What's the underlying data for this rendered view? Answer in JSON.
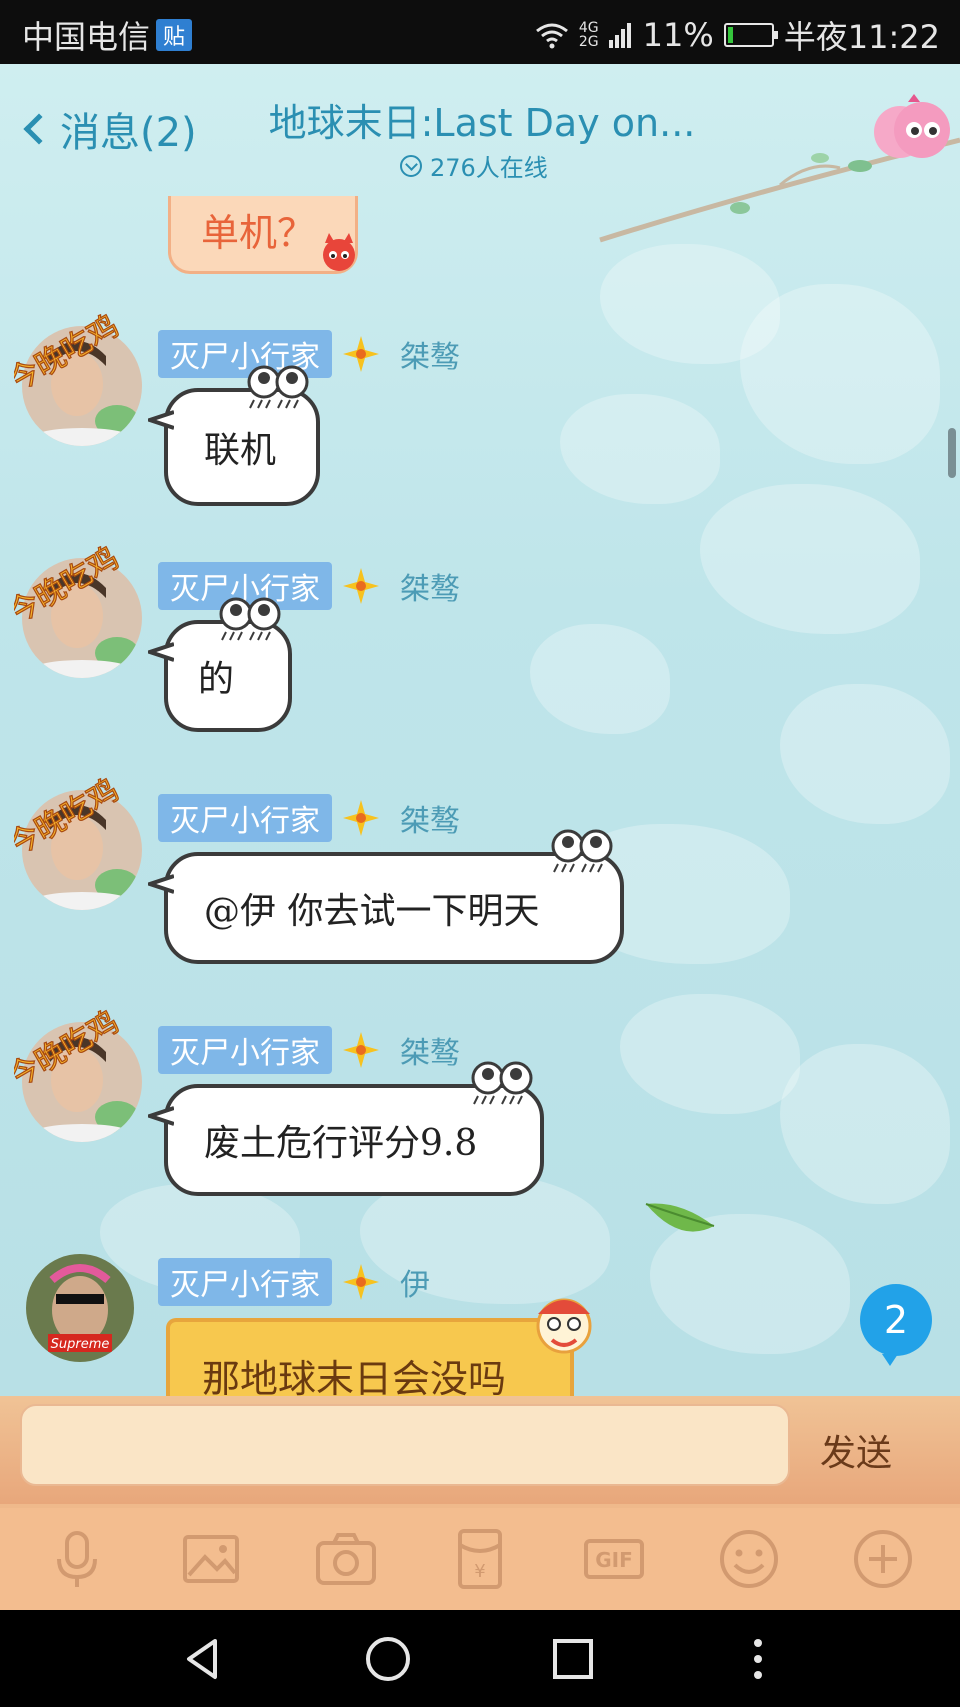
{
  "status_bar": {
    "carrier": "中国电信",
    "carrier_badge": "贴",
    "network": "4G",
    "network2": "2G",
    "battery_percent": "11%",
    "battery_level": 0.11,
    "time": "半夜11:22"
  },
  "header": {
    "back_label": "消息(2)",
    "title": "地球末日:Last Day on...",
    "online_count": "276人在线"
  },
  "partial_message": {
    "text": "单机？"
  },
  "messages": [
    {
      "title_tag": "灭尸小行家",
      "nickname": "桀骜",
      "text": "联机"
    },
    {
      "title_tag": "灭尸小行家",
      "nickname": "桀骜",
      "text": "的"
    },
    {
      "title_tag": "灭尸小行家",
      "nickname": "桀骜",
      "text": "@伊 你去试一下明天"
    },
    {
      "title_tag": "灭尸小行家",
      "nickname": "桀骜",
      "text": "废土危行评分9.8"
    },
    {
      "title_tag": "灭尸小行家",
      "nickname": "伊",
      "text": "那地球末日会没吗"
    }
  ],
  "avatar_sticker_text": "今晚吃鸡",
  "avatar2_label": "Supreme",
  "unread_badge": "2",
  "input": {
    "placeholder": "",
    "send_label": "发送"
  },
  "toolbar": {
    "icons": [
      "microphone-icon",
      "image-icon",
      "camera-icon",
      "red-packet-icon",
      "gif-icon",
      "emoji-icon",
      "plus-icon"
    ],
    "gif_label": "GIF",
    "red_packet_label": "¥"
  },
  "colors": {
    "accent": "#2a8fb2",
    "title_tag": "#7fb7e8",
    "unread": "#22a2e8",
    "toolbar_bg": "#f3bd8f"
  }
}
